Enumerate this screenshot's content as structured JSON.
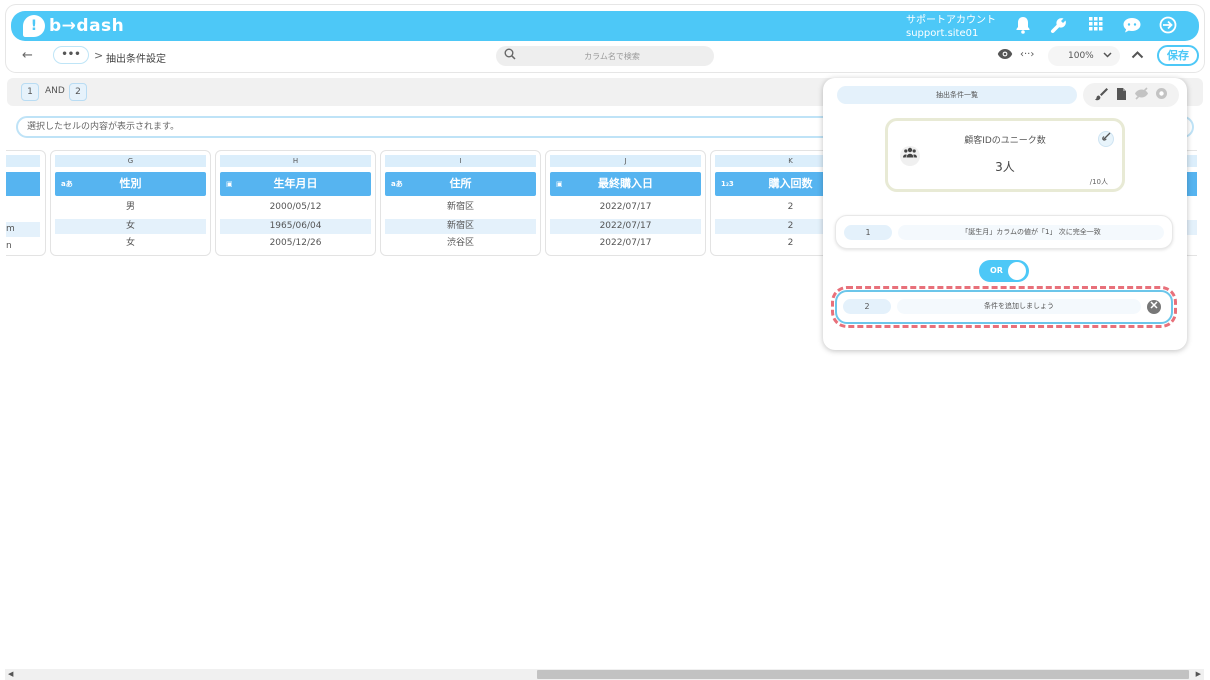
{
  "app": {
    "logo_text": "b→dash"
  },
  "header": {
    "account_line1": "サポートアカウント",
    "account_line2": "support.site01",
    "icons": [
      "bell-icon",
      "wrench-icon",
      "grid-icon",
      "chat-icon",
      "logout-icon"
    ]
  },
  "toolbar": {
    "back_label": "←",
    "more_label": "•••",
    "breadcrumb_sep": ">",
    "breadcrumb": "抽出条件設定",
    "search_placeholder": "カラム名で検索",
    "code_label": "‹··›",
    "zoom": "100%",
    "save_label": "保存"
  },
  "conditions": {
    "first": "1",
    "operator": "AND",
    "second": "2"
  },
  "cell_bar": {
    "text": "選択したセルの内容が表示されます。"
  },
  "partial_column": {
    "rows": [
      "",
      "m",
      "n"
    ]
  },
  "columns": [
    {
      "letter": "G",
      "type_icon": "aあ",
      "header": "性別",
      "rows": [
        "男",
        "女",
        "女"
      ]
    },
    {
      "letter": "H",
      "type_icon": "▣",
      "header": "生年月日",
      "rows": [
        "2000/05/12",
        "1965/06/04",
        "2005/12/26"
      ]
    },
    {
      "letter": "I",
      "type_icon": "aあ",
      "header": "住所",
      "rows": [
        "新宿区",
        "新宿区",
        "渋谷区"
      ]
    },
    {
      "letter": "J",
      "type_icon": "▣",
      "header": "最終購入日",
      "rows": [
        "2022/07/17",
        "2022/07/17",
        "2022/07/17"
      ]
    },
    {
      "letter": "K",
      "type_icon": "1₂3",
      "header": "購入回数",
      "rows": [
        "2",
        "2",
        "2"
      ]
    }
  ],
  "panel": {
    "title": "抽出条件一覧",
    "summary_label": "顧客IDのユニーク数",
    "summary_value": "3人",
    "summary_total": "/10人",
    "rule1_num": "1",
    "rule1_text": "「誕生月」カラムの値が「1」 次に完全一致",
    "toggle_label": "OR",
    "rule2_num": "2",
    "rule2_text": "条件を追加しましょう"
  },
  "colors": {
    "accent": "#4dc8f7",
    "column_header": "#56b4f0",
    "highlight": "#e8707a"
  }
}
